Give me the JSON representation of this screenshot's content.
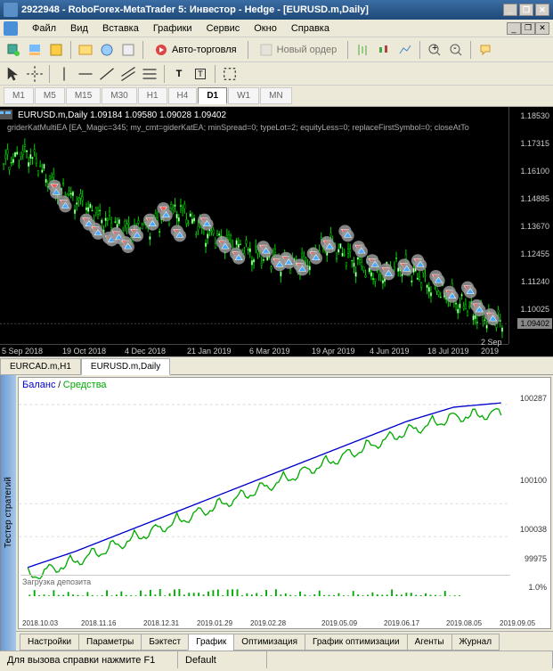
{
  "window": {
    "title": "2922948 - RoboForex-MetaTrader 5: Инвестор - Hedge - [EURUSD.m,Daily]"
  },
  "menu": {
    "items": [
      "Файл",
      "Вид",
      "Вставка",
      "Графики",
      "Сервис",
      "Окно",
      "Справка"
    ]
  },
  "toolbar": {
    "auto_trade": "Авто-торговля",
    "new_order": "Новый ордер"
  },
  "timeframes": [
    "M1",
    "M5",
    "M15",
    "M30",
    "H1",
    "H4",
    "D1",
    "W1",
    "MN"
  ],
  "timeframe_active": "D1",
  "chart": {
    "title": "EURUSD.m,Daily  1.09184 1.09580 1.09028 1.09402",
    "ea_info": "griderKatMultiEA [EA_Magic=345; my_cmt=giderKatEA; minSpread=0; typeLot=2; equityLess=0; replaceFirstSymbol=0; closeAtTo",
    "y_labels": [
      "1.18530",
      "1.17315",
      "1.16100",
      "1.14885",
      "1.13670",
      "1.12455",
      "1.11240",
      "1.10025"
    ],
    "price_current": "1.09402",
    "x_labels": [
      "5 Sep 2018",
      "19 Oct 2018",
      "4 Dec 2018",
      "21 Jan 2019",
      "6 Mar 2019",
      "19 Apr 2019",
      "4 Jun 2019",
      "18 Jul 2019",
      "2 Sep 2019"
    ]
  },
  "chart_tabs": [
    {
      "label": "EURCAD.m,H1",
      "active": false
    },
    {
      "label": "EURUSD.m,Daily",
      "active": true
    }
  ],
  "tester": {
    "side_label": "Тестер стратегий",
    "legend_balance": "Баланс",
    "legend_equity": "Средства",
    "deposit_label": "Загрузка депозита",
    "y_labels": [
      "100287",
      "100100",
      "100038",
      "99975",
      "1.0%"
    ],
    "x_labels": [
      "2018.10.03",
      "2018.11.16",
      "2018.12.31",
      "2019.01.29",
      "2019.02.28",
      "2019.05.09",
      "2019.06.17",
      "2019.08.05",
      "2019.09.05"
    ],
    "tabs": [
      "Настройки",
      "Параметры",
      "Бэктест",
      "График",
      "Оптимизация",
      "График оптимизации",
      "Агенты",
      "Журнал"
    ],
    "tab_active": "График"
  },
  "status": {
    "help": "Для вызова справки нажмите F1",
    "profile": "Default"
  },
  "chart_data": {
    "type": "candlestick+line",
    "price_chart": {
      "symbol": "EURUSD.m",
      "timeframe": "Daily",
      "y_range": [
        1.085,
        1.19
      ],
      "x_range": [
        "2018-09-05",
        "2019-09-10"
      ],
      "approx_path": [
        {
          "x": 0.0,
          "y": 1.165
        },
        {
          "x": 0.05,
          "y": 1.17
        },
        {
          "x": 0.1,
          "y": 1.155
        },
        {
          "x": 0.15,
          "y": 1.148
        },
        {
          "x": 0.2,
          "y": 1.14
        },
        {
          "x": 0.25,
          "y": 1.135
        },
        {
          "x": 0.3,
          "y": 1.138
        },
        {
          "x": 0.35,
          "y": 1.145
        },
        {
          "x": 0.4,
          "y": 1.135
        },
        {
          "x": 0.45,
          "y": 1.13
        },
        {
          "x": 0.5,
          "y": 1.125
        },
        {
          "x": 0.55,
          "y": 1.122
        },
        {
          "x": 0.6,
          "y": 1.12
        },
        {
          "x": 0.65,
          "y": 1.13
        },
        {
          "x": 0.7,
          "y": 1.122
        },
        {
          "x": 0.75,
          "y": 1.115
        },
        {
          "x": 0.8,
          "y": 1.12
        },
        {
          "x": 0.85,
          "y": 1.112
        },
        {
          "x": 0.9,
          "y": 1.105
        },
        {
          "x": 0.95,
          "y": 1.098
        },
        {
          "x": 1.0,
          "y": 1.094
        }
      ]
    },
    "equity_chart": {
      "y_range": [
        99975,
        100320
      ],
      "x_range": [
        "2018-10-03",
        "2019-09-05"
      ],
      "series": [
        {
          "name": "Баланс",
          "color": "#0000cc"
        },
        {
          "name": "Средства",
          "color": "#00aa00"
        }
      ],
      "approx_balance": [
        {
          "x": 0.0,
          "y": 99980
        },
        {
          "x": 0.1,
          "y": 100010
        },
        {
          "x": 0.2,
          "y": 100045
        },
        {
          "x": 0.3,
          "y": 100080
        },
        {
          "x": 0.4,
          "y": 100115
        },
        {
          "x": 0.5,
          "y": 100150
        },
        {
          "x": 0.6,
          "y": 100185
        },
        {
          "x": 0.7,
          "y": 100220
        },
        {
          "x": 0.8,
          "y": 100255
        },
        {
          "x": 0.9,
          "y": 100282
        },
        {
          "x": 1.0,
          "y": 100290
        }
      ]
    },
    "deposit_load": {
      "y_range": [
        0,
        1.2
      ],
      "type": "bar",
      "note": "sparse small green bars ~0.1-0.3%"
    }
  }
}
